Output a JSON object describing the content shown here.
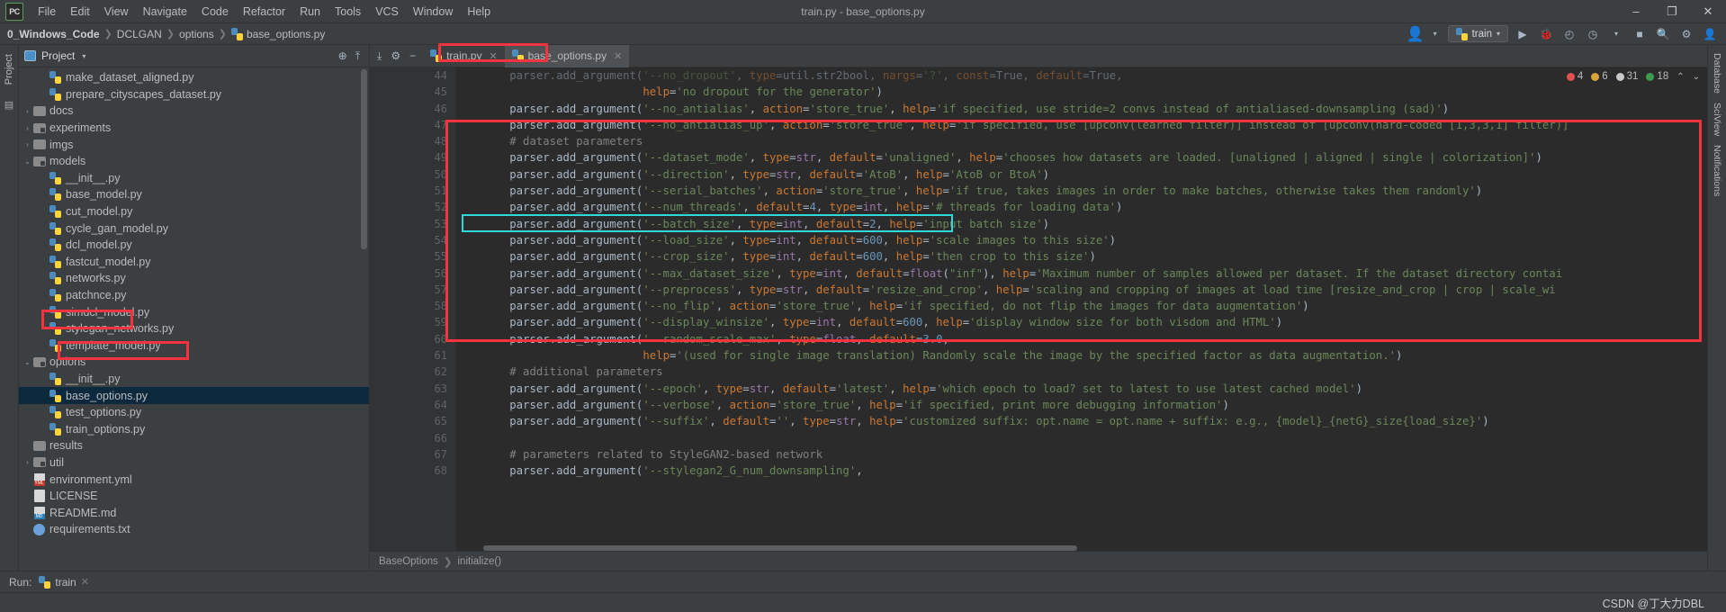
{
  "titlebar": {
    "logo": "PC",
    "menus": [
      "File",
      "Edit",
      "View",
      "Navigate",
      "Code",
      "Refactor",
      "Run",
      "Tools",
      "VCS",
      "Window",
      "Help"
    ],
    "window_title": "train.py - base_options.py",
    "minimize": "–",
    "maximize": "❐",
    "close": "✕"
  },
  "navbar": {
    "crumbs": [
      "0_Windows_Code",
      "DCLGAN",
      "options",
      "base_options.py"
    ],
    "separator": "❯",
    "run_config": "train",
    "run_icon": "▶",
    "debug_icon": "🐞",
    "coverage_icon": "◴",
    "profile_icon": "◷",
    "stop_icon": "■",
    "search_icon": "🔍",
    "settings_icon": "⚙",
    "avatar_icon": "👤"
  },
  "left_strip": {
    "project_tab": "Project",
    "structure_icon": "▤"
  },
  "project_panel": {
    "title": "Project",
    "caret": "▾",
    "locate_icon": "⊕",
    "collapse_icon": "⤒",
    "settings_icon": "⚙",
    "hide_icon": "−",
    "tree": [
      {
        "label": "make_dataset_aligned.py",
        "indent": 4,
        "arrow": "",
        "icon": "py",
        "selected": false
      },
      {
        "label": "prepare_cityscapes_dataset.py",
        "indent": 4,
        "arrow": "",
        "icon": "py",
        "selected": false
      },
      {
        "label": "docs",
        "indent": 3,
        "arrow": "›",
        "icon": "folder",
        "selected": false
      },
      {
        "label": "experiments",
        "indent": 3,
        "arrow": "›",
        "icon": "folder-src",
        "selected": false
      },
      {
        "label": "imgs",
        "indent": 3,
        "arrow": "›",
        "icon": "folder",
        "selected": false
      },
      {
        "label": "models",
        "indent": 3,
        "arrow": "⌄",
        "icon": "folder-src",
        "selected": false
      },
      {
        "label": "__init__.py",
        "indent": 4,
        "arrow": "",
        "icon": "py",
        "selected": false
      },
      {
        "label": "base_model.py",
        "indent": 4,
        "arrow": "",
        "icon": "py",
        "selected": false
      },
      {
        "label": "cut_model.py",
        "indent": 4,
        "arrow": "",
        "icon": "py",
        "selected": false
      },
      {
        "label": "cycle_gan_model.py",
        "indent": 4,
        "arrow": "",
        "icon": "py",
        "selected": false
      },
      {
        "label": "dcl_model.py",
        "indent": 4,
        "arrow": "",
        "icon": "py",
        "selected": false
      },
      {
        "label": "fastcut_model.py",
        "indent": 4,
        "arrow": "",
        "icon": "py",
        "selected": false
      },
      {
        "label": "networks.py",
        "indent": 4,
        "arrow": "",
        "icon": "py",
        "selected": false
      },
      {
        "label": "patchnce.py",
        "indent": 4,
        "arrow": "",
        "icon": "py",
        "selected": false
      },
      {
        "label": "simdcl_model.py",
        "indent": 4,
        "arrow": "",
        "icon": "py",
        "selected": false
      },
      {
        "label": "stylegan_networks.py",
        "indent": 4,
        "arrow": "",
        "icon": "py",
        "selected": false
      },
      {
        "label": "template_model.py",
        "indent": 4,
        "arrow": "",
        "icon": "py",
        "selected": false
      },
      {
        "label": "options",
        "indent": 3,
        "arrow": "⌄",
        "icon": "folder-src",
        "selected": false
      },
      {
        "label": "__init__.py",
        "indent": 4,
        "arrow": "",
        "icon": "py",
        "selected": false
      },
      {
        "label": "base_options.py",
        "indent": 4,
        "arrow": "",
        "icon": "py",
        "selected": true
      },
      {
        "label": "test_options.py",
        "indent": 4,
        "arrow": "",
        "icon": "py",
        "selected": false
      },
      {
        "label": "train_options.py",
        "indent": 4,
        "arrow": "",
        "icon": "py",
        "selected": false
      },
      {
        "label": "results",
        "indent": 3,
        "arrow": "",
        "icon": "folder",
        "selected": false
      },
      {
        "label": "util",
        "indent": 3,
        "arrow": "›",
        "icon": "folder-src",
        "selected": false
      },
      {
        "label": "environment.yml",
        "indent": 3,
        "arrow": "",
        "icon": "yml",
        "selected": false
      },
      {
        "label": "LICENSE",
        "indent": 3,
        "arrow": "",
        "icon": "txt",
        "selected": false
      },
      {
        "label": "README.md",
        "indent": 3,
        "arrow": "",
        "icon": "md",
        "selected": false
      },
      {
        "label": "requirements.txt",
        "indent": 3,
        "arrow": "",
        "icon": "reqs",
        "selected": false
      }
    ]
  },
  "editor": {
    "toolbar_icons": [
      "⤓",
      "⚙",
      "−"
    ],
    "tabs": [
      {
        "label": "train.py",
        "active": false,
        "close": "✕"
      },
      {
        "label": "base_options.py",
        "active": true,
        "close": "✕"
      }
    ],
    "inspections": {
      "error_count": "4",
      "warning_count": "6",
      "weak_warning_count": "31",
      "typo_count": "18",
      "error_color": "#e05252",
      "warning_color": "#d9a43b",
      "weak_color": "#c9c9c9",
      "typo_color": "#3c9b4e",
      "up_arrow": "⌃",
      "down_arrow": "⌄"
    },
    "first_line_number": 44,
    "lines": [
      {
        "n": 44,
        "text": "        parser.add_argument('--no_dropout', type=util.str2bool, nargs='?', const=True, default=True,",
        "clipped": true
      },
      {
        "n": 45,
        "text": "                            help='no dropout for the generator')"
      },
      {
        "n": 46,
        "text": "        parser.add_argument('--no_antialias', action='store_true', help='if specified, use stride=2 convs instead of antialiased-downsampling (sad)')"
      },
      {
        "n": 47,
        "text": "        parser.add_argument('--no_antialias_up', action='store_true', help='if specified, use [upconv(learned filter)] instead of [upconv(hard-coded [1,3,3,1] filter)]"
      },
      {
        "n": 48,
        "text": "        # dataset parameters"
      },
      {
        "n": 49,
        "text": "        parser.add_argument('--dataset_mode', type=str, default='unaligned', help='chooses how datasets are loaded. [unaligned | aligned | single | colorization]')"
      },
      {
        "n": 50,
        "text": "        parser.add_argument('--direction', type=str, default='AtoB', help='AtoB or BtoA')"
      },
      {
        "n": 51,
        "text": "        parser.add_argument('--serial_batches', action='store_true', help='if true, takes images in order to make batches, otherwise takes them randomly')"
      },
      {
        "n": 52,
        "text": "        parser.add_argument('--num_threads', default=4, type=int, help='# threads for loading data')"
      },
      {
        "n": 53,
        "text": "        parser.add_argument('--batch_size', type=int, default=2, help='input batch size')"
      },
      {
        "n": 54,
        "text": "        parser.add_argument('--load_size', type=int, default=600, help='scale images to this size')"
      },
      {
        "n": 55,
        "text": "        parser.add_argument('--crop_size', type=int, default=600, help='then crop to this size')"
      },
      {
        "n": 56,
        "text": "        parser.add_argument('--max_dataset_size', type=int, default=float(\"inf\"), help='Maximum number of samples allowed per dataset. If the dataset directory contai"
      },
      {
        "n": 57,
        "text": "        parser.add_argument('--preprocess', type=str, default='resize_and_crop', help='scaling and cropping of images at load time [resize_and_crop | crop | scale_wi"
      },
      {
        "n": 58,
        "text": "        parser.add_argument('--no_flip', action='store_true', help='if specified, do not flip the images for data augmentation')"
      },
      {
        "n": 59,
        "text": "        parser.add_argument('--display_winsize', type=int, default=600, help='display window size for both visdom and HTML')"
      },
      {
        "n": 60,
        "text": "        parser.add_argument('--random_scale_max', type=float, default=3.0,"
      },
      {
        "n": 61,
        "text": "                            help='(used for single image translation) Randomly scale the image by the specified factor as data augmentation.')"
      },
      {
        "n": 62,
        "text": "        # additional parameters"
      },
      {
        "n": 63,
        "text": "        parser.add_argument('--epoch', type=str, default='latest', help='which epoch to load? set to latest to use latest cached model')"
      },
      {
        "n": 64,
        "text": "        parser.add_argument('--verbose', action='store_true', help='if specified, print more debugging information')"
      },
      {
        "n": 65,
        "text": "        parser.add_argument('--suffix', default='', type=str, help='customized suffix: opt.name = opt.name + suffix: e.g., {model}_{netG}_size{load_size}')"
      },
      {
        "n": 66,
        "text": ""
      },
      {
        "n": 67,
        "text": "        # parameters related to StyleGAN2-based network"
      },
      {
        "n": 68,
        "text": "        parser.add_argument('--stylegan2_G_num_downsampling',"
      }
    ],
    "breadcrumb": [
      "BaseOptions",
      "initialize()"
    ],
    "breadcrumb_sep": "❯"
  },
  "right_strip": {
    "tabs": [
      "Database",
      "SciView",
      "Notifications"
    ]
  },
  "runbar": {
    "label": "Run:",
    "tab": "train",
    "close": "✕"
  },
  "statusbar": {
    "watermark": "CSDN @丁大力DBL"
  }
}
